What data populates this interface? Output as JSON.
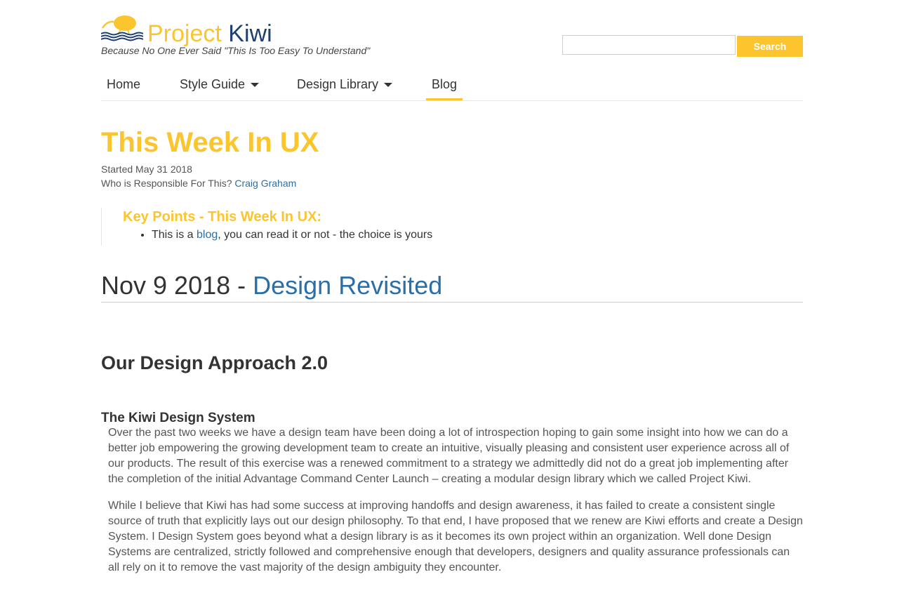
{
  "header": {
    "brand_part1": "Project",
    "brand_part2": "Kiwi",
    "tagline": "Because No One Ever Said \"This Is Too Easy To Understand\"",
    "search": {
      "value": "",
      "placeholder": "",
      "button_label": "Search"
    },
    "logo_icon": "kiwi-bird-icon"
  },
  "nav": {
    "items": [
      {
        "label": "Home",
        "dropdown": false,
        "active": false
      },
      {
        "label": "Style Guide",
        "dropdown": true,
        "active": false
      },
      {
        "label": "Design Library",
        "dropdown": true,
        "active": false
      },
      {
        "label": "Blog",
        "dropdown": false,
        "active": true
      }
    ]
  },
  "page": {
    "title": "This Week In UX",
    "started": "Started May 31 2018",
    "responsible_label": "Who is Responsible For This?",
    "responsible_name": "Craig Graham"
  },
  "key_points": {
    "heading": "Key Points - This Week In UX:",
    "item_prefix": "This is a ",
    "item_link": "blog",
    "item_suffix": ", you can read it or not - the choice is yours"
  },
  "post": {
    "date": "Nov 9 2018 - ",
    "title_link": "Design Revisited",
    "section_title": "Our Design Approach 2.0",
    "subsection_title": "The Kiwi Design System",
    "paragraphs": [
      "Over the past two weeks we have a design team have been doing a lot of introspection hoping to gain some insight into how we can do a better job empowering the growing development team to create an intuitive, visually pleasing and consistent user experience across all of our products. The result of this exercise was a renewed commitment to a strategy we admittedly did not do a great job implementing after the completion of the initial Advantage Command Center Launch – creating a modular design library which we called Project Kiwi.",
      "While I believe that Kiwi has had some success at improving handoffs and design awareness, it has failed to create a consistent single source of truth that explicitly lays out our design philosophy. To that end, I have proposed that we renew are Kiwi efforts and create a Design System. I Design System goes beyond what a design library is as it becomes its own project within an organization. Well done Design Systems are centralized, strictly followed and comprehensive enough that developers, designers and quality assurance professionals can all rely on it to remove the vast majority of the design ambiguity they encounter."
    ]
  },
  "colors": {
    "accent": "#fcc52d",
    "link": "#2a6fa8",
    "brand_dark": "#1f3f6e",
    "text": "#333333"
  }
}
